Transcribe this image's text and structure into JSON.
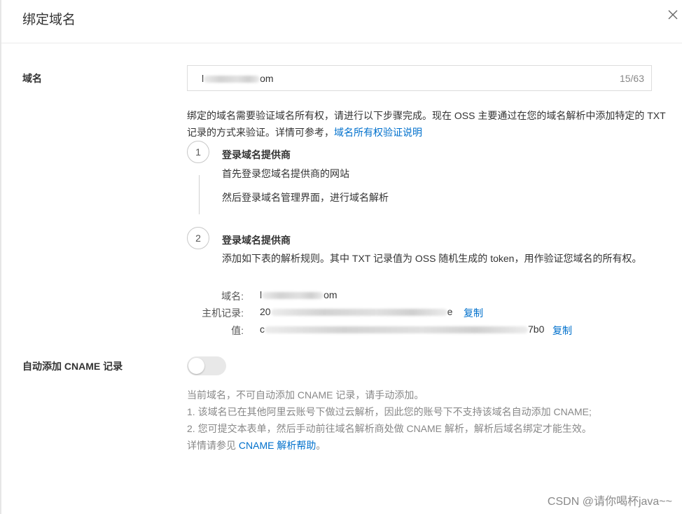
{
  "dialog": {
    "title": "绑定域名",
    "close_icon": "close-icon"
  },
  "domain_field": {
    "label": "域名",
    "value_prefix": "l",
    "value_suffix": "om",
    "counter": "15/63"
  },
  "description": {
    "text": "绑定的域名需要验证域名所有权，请进行以下步骤完成。现在 OSS 主要通过在您的域名解析中添加特定的 TXT 记录的方式来验证。详情可参考，",
    "link": "域名所有权验证说明"
  },
  "steps": [
    {
      "number": "1",
      "title": "登录域名提供商",
      "lines": [
        "首先登录您域名提供商的网站",
        "然后登录域名管理界面，进行域名解析"
      ]
    },
    {
      "number": "2",
      "title": "登录域名提供商",
      "lines": [
        "添加如下表的解析规则。其中 TXT 记录值为 OSS 随机生成的 token，用作验证您域名的所有权。"
      ]
    }
  ],
  "record": {
    "domain_label": "域名:",
    "domain_prefix": "l",
    "domain_suffix": "om",
    "host_label": "主机记录:",
    "host_prefix": "20",
    "host_suffix": "e",
    "value_label": "值:",
    "value_prefix": "c",
    "value_suffix": "7b0",
    "copy_label": "复制"
  },
  "auto_cname": {
    "label": "自动添加 CNAME 记录",
    "enabled": false,
    "hints": [
      "当前域名，不可自动添加 CNAME 记录，请手动添加。",
      "1. 该域名已在其他阿里云账号下做过云解析，因此您的账号下不支持该域名自动添加 CNAME;",
      "2. 您可提交本表单，然后手动前往域名解析商处做 CNAME 解析，解析后域名绑定才能生效。"
    ],
    "help_prefix": "详情请参见 ",
    "help_link": "CNAME 解析帮助",
    "help_suffix": "。"
  },
  "watermark": "CSDN @请你喝杯java~~",
  "colors": {
    "link": "#0070cc",
    "text": "#333333",
    "hint": "#888888",
    "toggle_off": "#e8e8e8"
  }
}
